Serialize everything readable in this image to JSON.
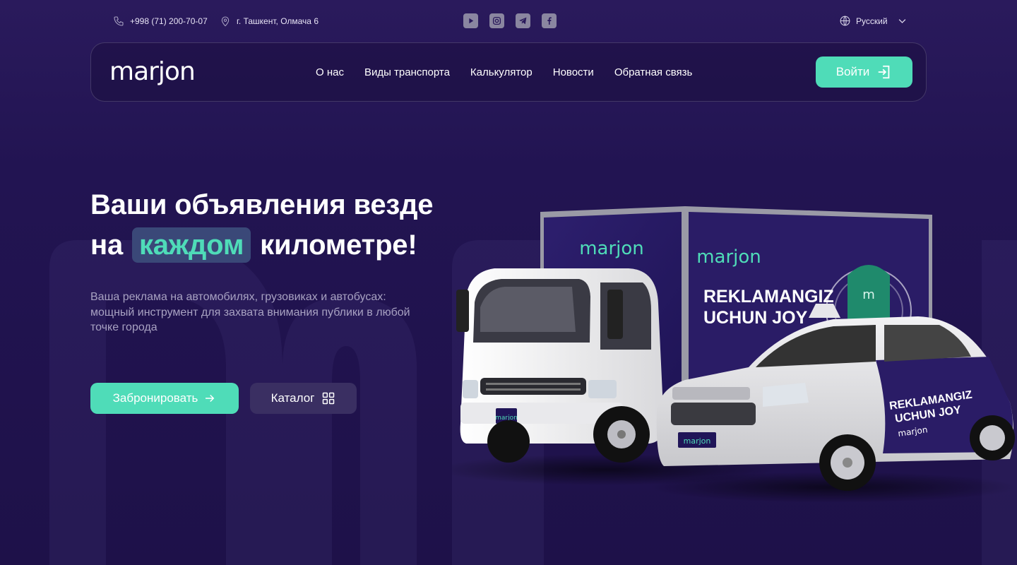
{
  "topbar": {
    "phone": "+998 (71) 200-70-07",
    "address": "г. Ташкент, Олмача 6",
    "socials": [
      "youtube-icon",
      "instagram-icon",
      "telegram-icon",
      "facebook-icon"
    ],
    "language": "Русский"
  },
  "header": {
    "logo": "marjon",
    "nav": [
      "О нас",
      "Виды транспорта",
      "Калькулятор",
      "Новости",
      "Обратная связь"
    ],
    "login": "Войти"
  },
  "hero": {
    "title_line1": "Ваши объявления везде",
    "title_pre": "на",
    "title_highlight": "каждом",
    "title_post": "километре!",
    "description": "Ваша реклама на автомобилях, грузовиках и автобусах: мощный инструмент для захвата внимания публики в любой точке города",
    "book_button": "Забронировать",
    "catalog_button": "Каталог"
  },
  "vehicle_ad": {
    "brand": "marjon",
    "slogan_line1": "REKLAMANGIZ",
    "slogan_line2": "UCHUN JOY",
    "truck_plate": "marjon",
    "car_plate": "marjon",
    "car_brand": "marjon"
  },
  "colors": {
    "accent": "#4fdcb8",
    "background": "#221452",
    "highlight_bg": "#3a4878",
    "secondary_button": "#3a2f62"
  }
}
